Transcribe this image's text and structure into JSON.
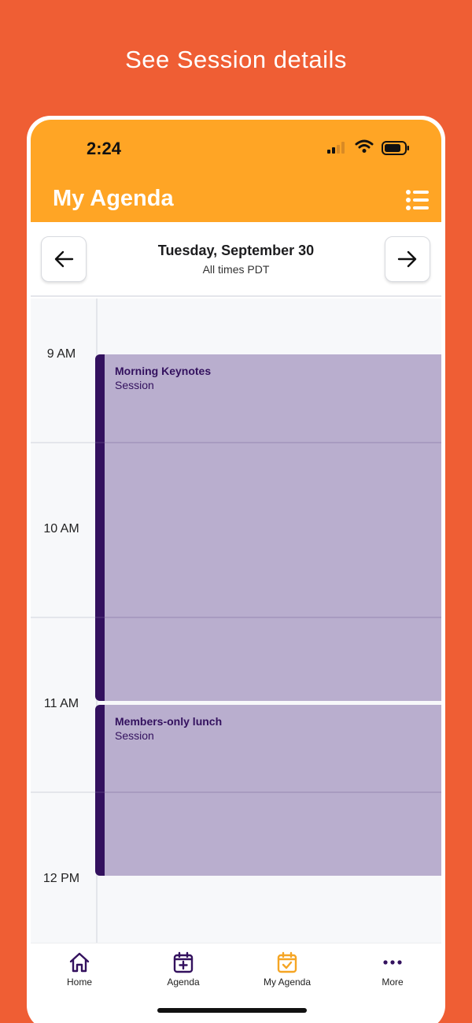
{
  "promo": {
    "caption": "See Session details"
  },
  "status_bar": {
    "time": "2:24"
  },
  "header": {
    "title": "My Agenda"
  },
  "date_nav": {
    "date": "Tuesday, September 30",
    "timezone_note": "All times PDT"
  },
  "calendar": {
    "hours": [
      "9 AM",
      "10 AM",
      "11 AM",
      "12 PM"
    ],
    "events": [
      {
        "title": "Morning Keynotes",
        "type": "Session"
      },
      {
        "title": "Members-only lunch",
        "type": "Session"
      }
    ]
  },
  "tabbar": {
    "tabs": [
      {
        "label": "Home",
        "icon": "home-icon"
      },
      {
        "label": "Agenda",
        "icon": "calendar-plus-icon"
      },
      {
        "label": "My Agenda",
        "icon": "calendar-check-icon"
      },
      {
        "label": "More",
        "icon": "more-dots-icon"
      }
    ],
    "active_tab": "My Agenda"
  },
  "colors": {
    "background": "#EF5E34",
    "header": "#FFA525",
    "event_fill": "#B9AECE",
    "event_accent": "#33115E",
    "active_tab": "#F5A524"
  }
}
